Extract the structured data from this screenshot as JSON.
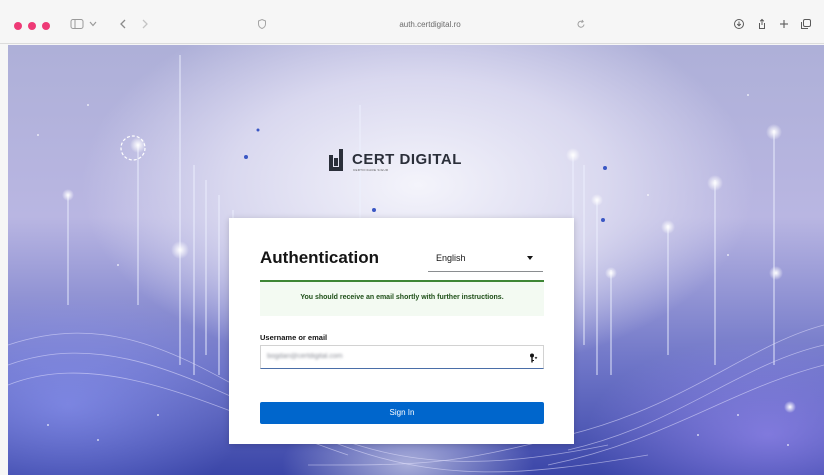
{
  "browser": {
    "url": "auth.certdigital.ro",
    "colors": {
      "traffic_light": "#ee3a76",
      "toolbar_bg": "#f6f6f6"
    },
    "icons": [
      "sidebar-icon",
      "chevron-down-icon",
      "back-icon",
      "forward-icon",
      "shield-icon",
      "reload-icon",
      "download-icon",
      "share-icon",
      "plus-icon",
      "tabs-icon"
    ]
  },
  "brand": {
    "name": "CERT DIGITAL",
    "tagline": "CERTIFICARE SIGUR"
  },
  "auth": {
    "title": "Authentication",
    "language": "English",
    "alert_message": "You should receive an email shortly with further instructions.",
    "username_label": "Username or email",
    "username_value": "bogdan@certdigital.com",
    "sign_in_label": "Sign In",
    "colors": {
      "primary": "#0066cc",
      "success_border": "#3e8635",
      "success_bg": "#f3faf2"
    }
  }
}
